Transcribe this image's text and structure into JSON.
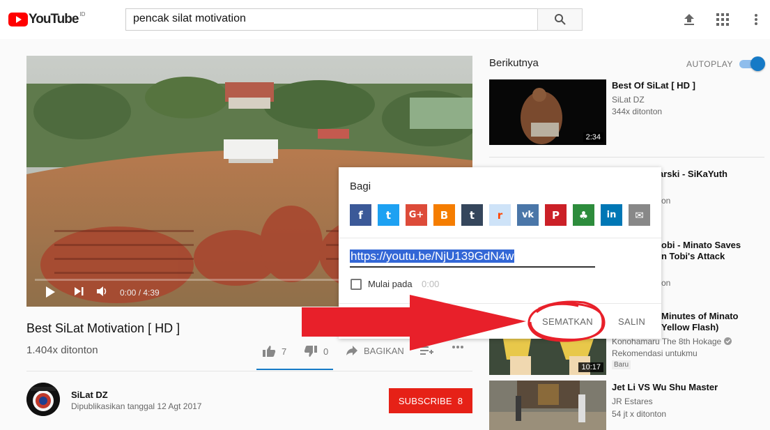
{
  "masthead": {
    "logo_text": "YouTube",
    "country_code": "ID",
    "search_value": "pencak silat motivation",
    "icons": [
      "search-icon",
      "upload-icon",
      "apps-grid-icon",
      "more-vert-icon"
    ]
  },
  "player": {
    "time": "0:00 / 4:39",
    "progress": 0
  },
  "video": {
    "title": "Best SiLat Motivation [ HD ]",
    "views": "1.404x ditonton",
    "likes": "7",
    "dislikes": "0",
    "share_label": "BAGIKAN"
  },
  "channel": {
    "name": "SiLat DZ",
    "published": "Dipublikasikan tanggal 12 Agt 2017",
    "subscribe_label": "SUBSCRIBE",
    "subscriber_count": "8"
  },
  "sidebar": {
    "up_next": "Berikutnya",
    "autoplay": "AUTOPLAY",
    "autoplay_on": true,
    "items": [
      {
        "title": "Best Of SiLat [ HD ]",
        "channel": "SiLat DZ",
        "views": "344x ditonton",
        "duration": "2:34"
      },
      {
        "title": "arski - SiKaYuth",
        "channel": "",
        "views": "on"
      },
      {
        "title_line1": "obi - Minato Saves",
        "title_line2": "n Tobi's Attack",
        "views": "on"
      },
      {
        "title_line1": "Minutes of Minato",
        "title_line2": "Yellow Flash)",
        "channel": "Konohamaru The 8th Hokage",
        "meta": "Rekomendasi untukmu",
        "badge": "Baru",
        "duration": "10:17"
      },
      {
        "title": "Jet Li VS Wu Shu Master",
        "channel": "JR Estares",
        "views": "54 jt x ditonton"
      }
    ]
  },
  "share_dialog": {
    "title": "Bagi",
    "url": "https://youtu.be/NjU139GdN4w",
    "start_label": "Mulai pada",
    "start_time": "0:00",
    "embed_label": "SEMATKAN",
    "copy_label": "SALIN",
    "services": [
      {
        "name": "facebook",
        "glyph": "f",
        "color": "#3b5998"
      },
      {
        "name": "twitter",
        "glyph": "t",
        "color": "#1da1f2"
      },
      {
        "name": "google-plus",
        "glyph": "G+",
        "color": "#dd4b39"
      },
      {
        "name": "blogger",
        "glyph": "B",
        "color": "#f57d00"
      },
      {
        "name": "tumblr",
        "glyph": "t",
        "color": "#35465c"
      },
      {
        "name": "reddit",
        "glyph": "r",
        "color": "#cee3f8"
      },
      {
        "name": "vk",
        "glyph": "vk",
        "color": "#4a76a8"
      },
      {
        "name": "pinterest",
        "glyph": "P",
        "color": "#cb2027"
      },
      {
        "name": "ameba",
        "glyph": "♣",
        "color": "#2d8c3c"
      },
      {
        "name": "linkedin",
        "glyph": "in",
        "color": "#0077b5"
      },
      {
        "name": "email",
        "glyph": "✉",
        "color": "#888888"
      }
    ]
  },
  "colors": {
    "brand_red": "#ff0000",
    "subscribe_red": "#e62117",
    "link_blue": "#167ac6",
    "annotation_red": "#e8202a"
  }
}
